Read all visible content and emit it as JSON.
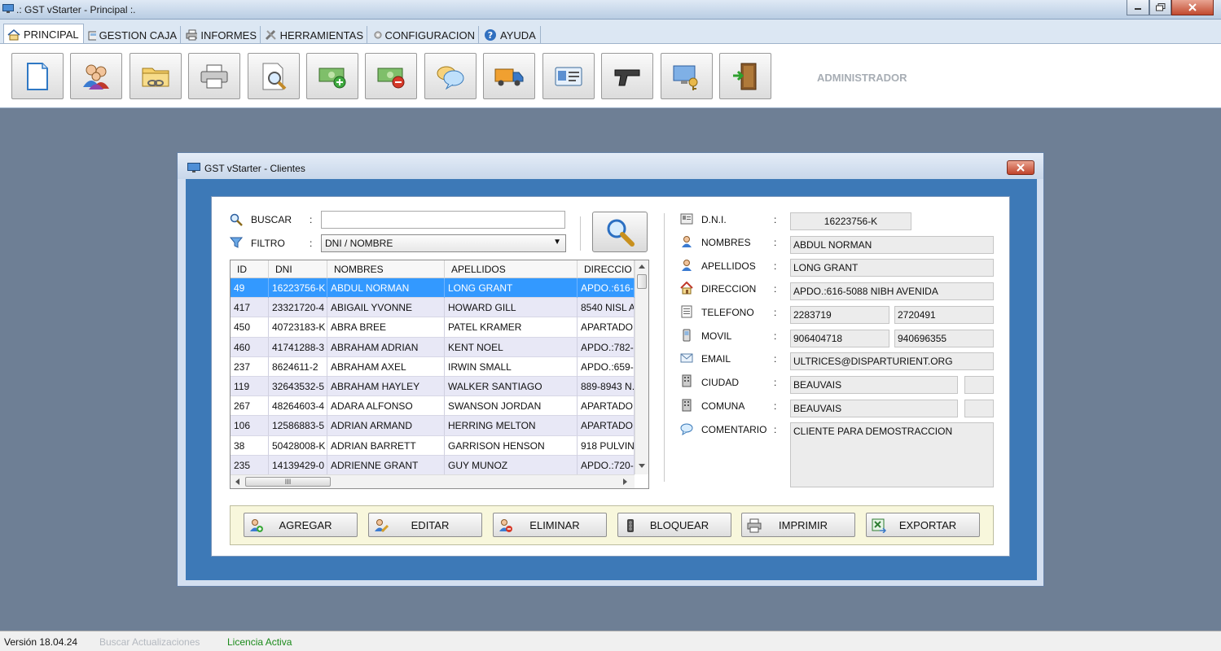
{
  "window": {
    "title": ".: GST vStarter - Principal :."
  },
  "tabs": [
    {
      "label": "PRINCIPAL",
      "icon": "home-icon"
    },
    {
      "label": "GESTION CAJA",
      "icon": "cash-register-icon"
    },
    {
      "label": "INFORMES",
      "icon": "printer-icon"
    },
    {
      "label": "HERRAMIENTAS",
      "icon": "tools-icon"
    },
    {
      "label": "CONFIGURACION",
      "icon": "config-icon"
    },
    {
      "label": "AYUDA",
      "icon": "help-icon"
    }
  ],
  "toolbar": {
    "buttons": [
      {
        "icon": "new-document-icon"
      },
      {
        "icon": "users-icon"
      },
      {
        "icon": "folder-link-icon"
      },
      {
        "icon": "printer-icon"
      },
      {
        "icon": "document-search-icon"
      },
      {
        "icon": "money-add-icon"
      },
      {
        "icon": "money-remove-icon"
      },
      {
        "icon": "chat-bubbles-icon"
      },
      {
        "icon": "delivery-truck-icon"
      },
      {
        "icon": "id-card-icon"
      },
      {
        "icon": "pistol-icon"
      },
      {
        "icon": "computer-key-icon"
      },
      {
        "icon": "exit-door-icon"
      }
    ],
    "role_label": "ADMINISTRADOR"
  },
  "dialog": {
    "title": "GST vStarter - Clientes",
    "search": {
      "label": "BUSCAR",
      "value": "",
      "filter_label": "FILTRO",
      "filter_value": "DNI / NOMBRE"
    },
    "grid": {
      "columns": [
        "ID",
        "DNI",
        "NOMBRES",
        "APELLIDOS",
        "DIRECCIO"
      ],
      "rows": [
        [
          "49",
          "16223756-K",
          "ABDUL NORMAN",
          "LONG GRANT",
          "APDO.:616-"
        ],
        [
          "417",
          "23321720-4",
          "ABIGAIL YVONNE",
          "HOWARD GILL",
          "8540 NISL A"
        ],
        [
          "450",
          "40723183-K",
          "ABRA BREE",
          "PATEL KRAMER",
          "APARTADO"
        ],
        [
          "460",
          "41741288-3",
          "ABRAHAM ADRIAN",
          "KENT NOEL",
          "APDO.:782-"
        ],
        [
          "237",
          "8624611-2",
          "ABRAHAM AXEL",
          "IRWIN SMALL",
          "APDO.:659-"
        ],
        [
          "119",
          "32643532-5",
          "ABRAHAM HAYLEY",
          "WALKER SANTIAGO",
          "889-8943 N."
        ],
        [
          "267",
          "48264603-4",
          "ADARA ALFONSO",
          "SWANSON JORDAN",
          "APARTADO"
        ],
        [
          "106",
          "12586883-5",
          "ADRIAN ARMAND",
          "HERRING MELTON",
          "APARTADO"
        ],
        [
          "38",
          "50428008-K",
          "ADRIAN BARRETT",
          "GARRISON HENSON",
          "918 PULVIN"
        ],
        [
          "235",
          "14139429-0",
          "ADRIENNE GRANT",
          "GUY MUNOZ",
          "APDO.:720-"
        ]
      ],
      "hscroll_marker": "III"
    },
    "detail": {
      "dni_label": "D.N.I.",
      "dni": "16223756-K",
      "nombres_label": "NOMBRES",
      "nombres": "ABDUL NORMAN",
      "apellidos_label": "APELLIDOS",
      "apellidos": "LONG GRANT",
      "direccion_label": "DIRECCION",
      "direccion": "APDO.:616-5088 NIBH AVENIDA",
      "telefono_label": "TELEFONO",
      "telefono1": "2283719",
      "telefono2": "2720491",
      "movil_label": "MOVIL",
      "movil1": "906404718",
      "movil2": "940696355",
      "email_label": "EMAIL",
      "email": "ULTRICES@DISPARTURIENT.ORG",
      "ciudad_label": "CIUDAD",
      "ciudad": "BEAUVAIS",
      "ciudad_code": "",
      "comuna_label": "COMUNA",
      "comuna": "BEAUVAIS",
      "comuna_code": "",
      "comentario_label": "COMENTARIO",
      "comentario": "CLIENTE PARA DEMOSTRACCION"
    },
    "actions": [
      "AGREGAR",
      "EDITAR",
      "ELIMINAR",
      "BLOQUEAR",
      "IMPRIMIR",
      "EXPORTAR"
    ]
  },
  "status": {
    "version": "Versión 18.04.24",
    "updates": "Buscar Actualizaciones",
    "license": "Licencia Activa"
  },
  "colors": {
    "selected_row": "#3399ff",
    "dialog_frame": "#3d79b7",
    "desktop": "#6e7f95",
    "license_green": "#1a8a1a"
  }
}
